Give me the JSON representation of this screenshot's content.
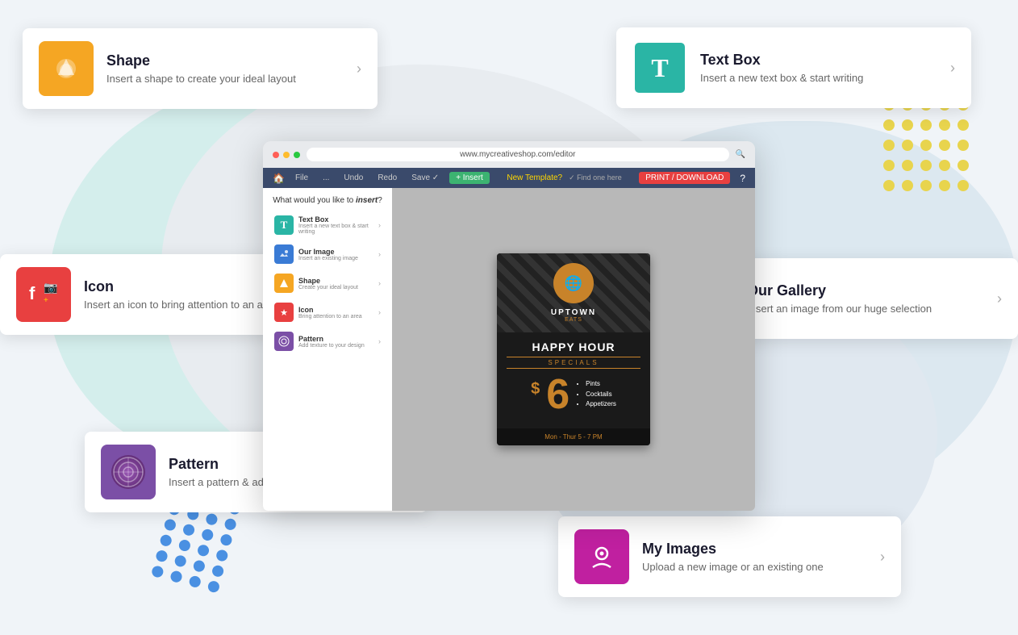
{
  "background": {
    "color": "#f0f4f8"
  },
  "cards": {
    "shape": {
      "title": "Shape",
      "description": "Insert a shape to create your ideal layout",
      "icon_color": "#f5a623",
      "icon_emoji": "🔶"
    },
    "textbox": {
      "title": "Text Box",
      "description": "Insert a new text box & start writing",
      "icon_color": "#2ab5a5",
      "icon_char": "T"
    },
    "icon": {
      "title": "Icon",
      "description": "Insert an icon to bring attention to an area",
      "icon_color": "#e84040"
    },
    "gallery": {
      "title": "Our Gallery",
      "description": "Insert an image from our huge selection",
      "icon_color": "#2c4a7c"
    },
    "pattern": {
      "title": "Pattern",
      "description": "Insert a pattern & add texture",
      "icon_color": "#7b4fa6"
    },
    "myimages": {
      "title": "My Images",
      "description": "Upload a new image or an existing one",
      "icon_color": "#c020a0"
    }
  },
  "browser": {
    "url": "www.mycreativeshop.com/editor"
  },
  "insert_panel": {
    "title": "What would you like to",
    "title_italic": "insert",
    "items": [
      {
        "name": "Text Box",
        "desc": "Insert a new text box & start writing",
        "icon_color": "#2ab5a5"
      },
      {
        "name": "Our Image",
        "desc": "Insert an existing image",
        "icon_color": "#3a7bd5"
      },
      {
        "name": "Shape",
        "desc": "Create your ideal layout",
        "icon_color": "#f5a623"
      },
      {
        "name": "Icon",
        "desc": "Bring attention to an area",
        "icon_color": "#e84040"
      },
      {
        "name": "Pattern",
        "desc": "Add texture to your design",
        "icon_color": "#7b4fa6"
      }
    ]
  },
  "flyer": {
    "brand": "UPTOWN",
    "brand_sub": "EATS",
    "happy": "HAPPY HOUR",
    "specials": "SPECIALS",
    "price_dollar": "$",
    "price": "6",
    "items": [
      "Pints",
      "Cocktails",
      "Appetizers"
    ],
    "hours": "Mon - Thur    5 - 7 PM"
  },
  "toolbar": {
    "new_template": "New Template?",
    "find_one": "✓ Find one here",
    "print": "PRINT / DOWNLOAD"
  }
}
